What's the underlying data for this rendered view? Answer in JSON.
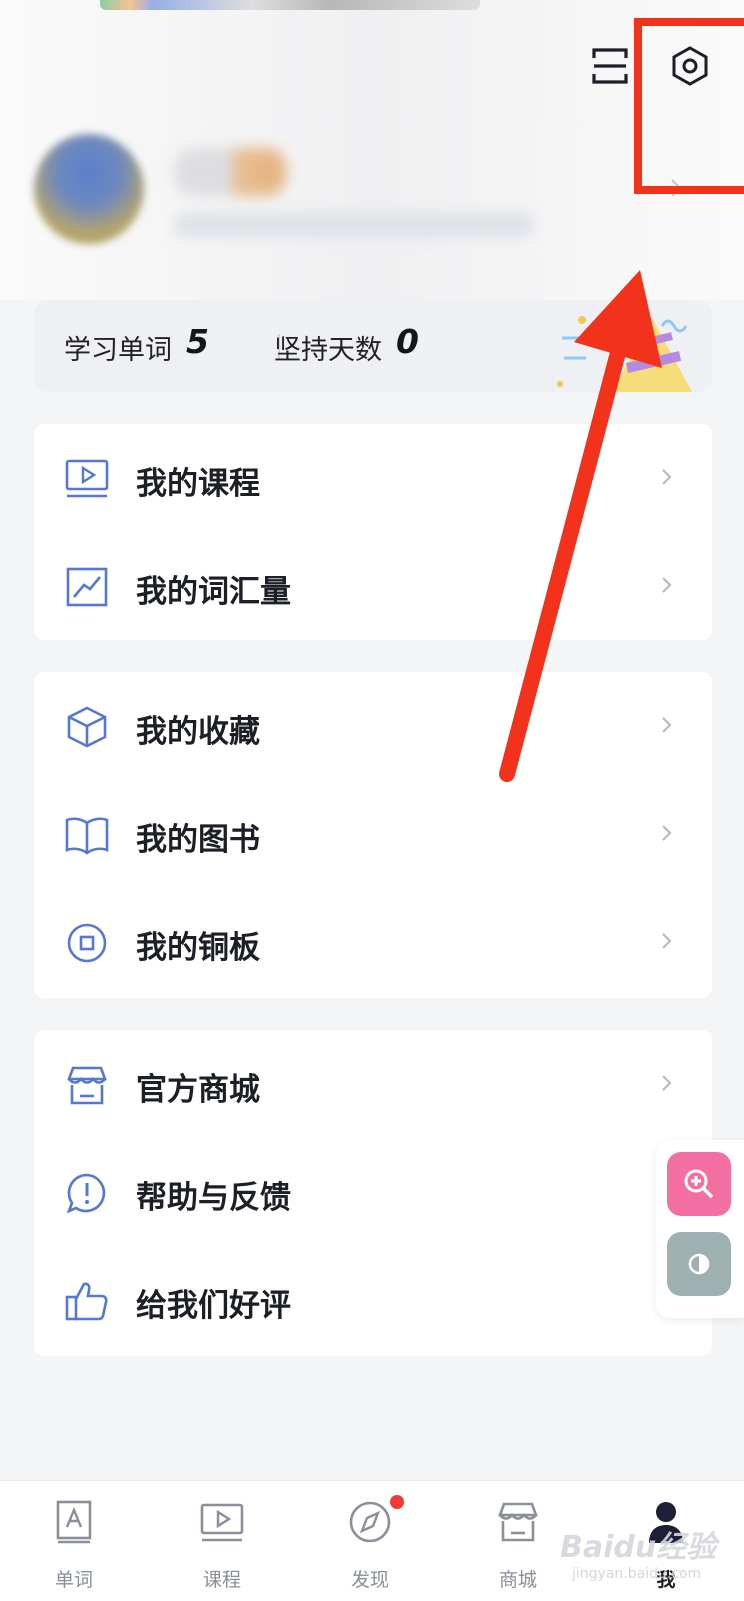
{
  "header": {
    "scan_icon": "scan-icon",
    "settings_icon": "hexagon-settings-icon"
  },
  "stats": {
    "words_label": "学习单词",
    "words_value": "5",
    "days_label": "坚持天数",
    "days_value": "0"
  },
  "menu_groups": [
    [
      {
        "label": "我的课程",
        "icon": "course-screen-icon"
      },
      {
        "label": "我的词汇量",
        "icon": "vocabulary-chart-icon"
      }
    ],
    [
      {
        "label": "我的收藏",
        "icon": "favorite-box-icon"
      },
      {
        "label": "我的图书",
        "icon": "book-icon"
      },
      {
        "label": "我的铜板",
        "icon": "coin-icon"
      }
    ],
    [
      {
        "label": "官方商城",
        "icon": "store-icon"
      },
      {
        "label": "帮助与反馈",
        "icon": "help-feedback-icon"
      },
      {
        "label": "给我们好评",
        "icon": "thumbs-up-icon"
      }
    ]
  ],
  "floating": {
    "zoom_icon": "zoom-in-icon",
    "contrast_icon": "contrast-icon"
  },
  "tabbar": {
    "tabs": [
      {
        "label": "单词",
        "icon": "word-card-icon"
      },
      {
        "label": "课程",
        "icon": "course-screen-icon"
      },
      {
        "label": "发现",
        "icon": "compass-icon"
      },
      {
        "label": "商城",
        "icon": "store-icon"
      },
      {
        "label": "我",
        "icon": "person-icon"
      }
    ],
    "active_index": 4
  },
  "watermark": {
    "text": "Baidu经验",
    "sub": "jingyan.baidu.com"
  },
  "colors": {
    "accent_blue": "#5577d6",
    "annotation_red": "#f2321b",
    "zoom_pink": "#f36fa1",
    "contrast_gray": "#9fb0b0",
    "badge_red": "#ef3a36"
  }
}
